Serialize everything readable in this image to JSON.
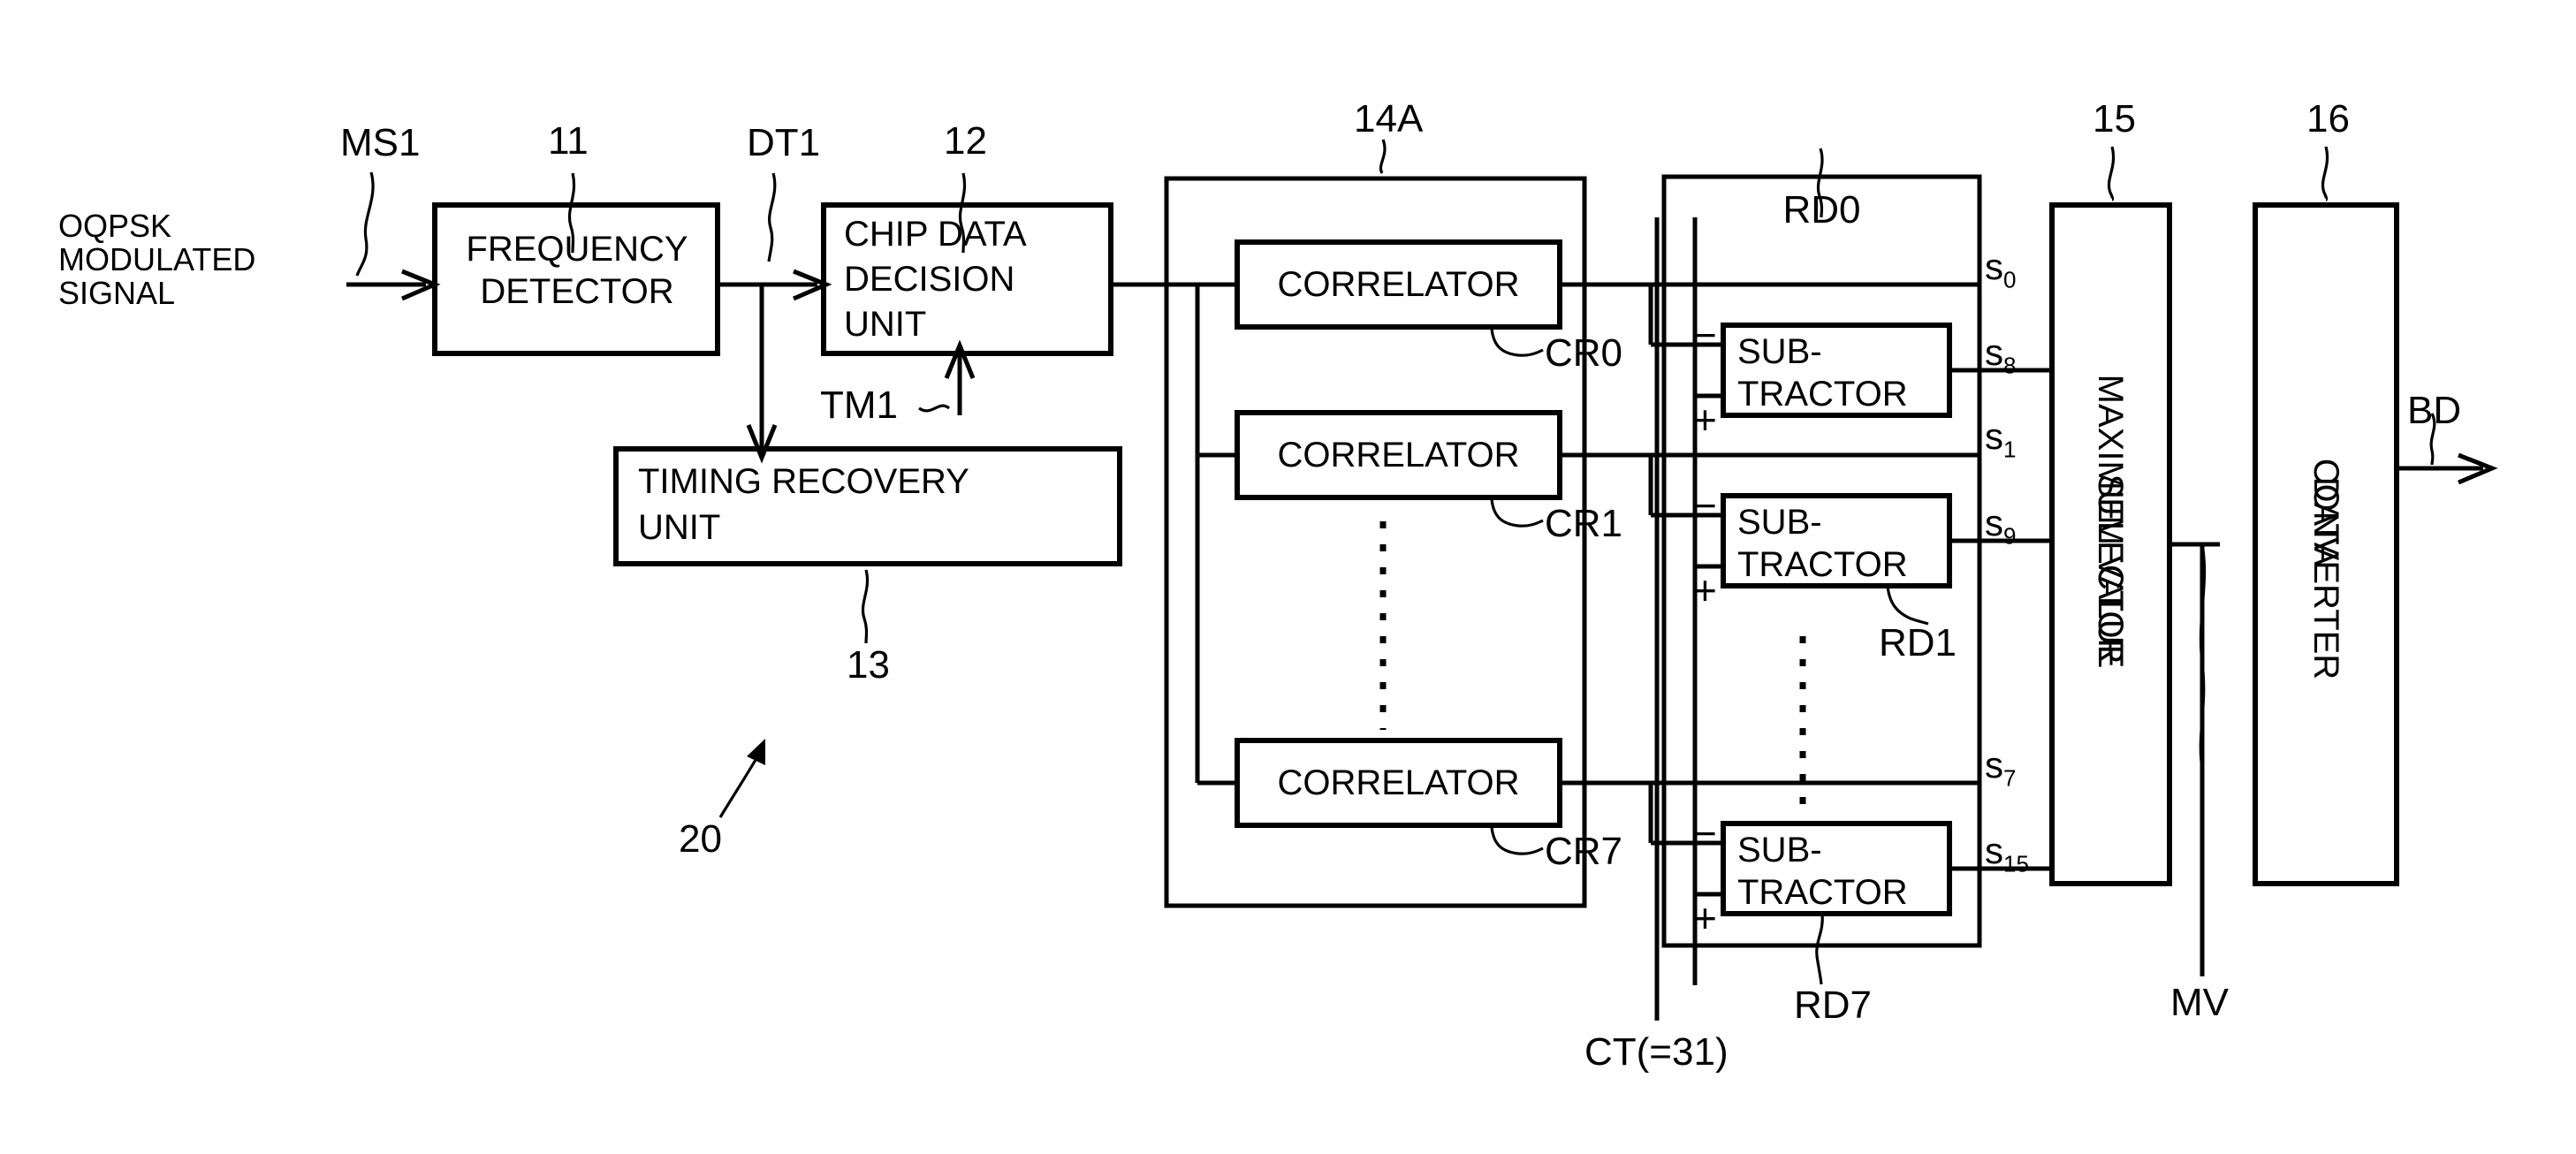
{
  "figure": {
    "type": "patent-block-diagram",
    "overall_ref": "20"
  },
  "input": {
    "label_line1": "OQPSK",
    "label_line2": "MODULATED",
    "label_line3": "SIGNAL",
    "signal_ref": "MS1"
  },
  "blocks": {
    "frequency_detector": {
      "line1": "FREQUENCY",
      "line2": "DETECTOR",
      "ref": "11"
    },
    "chip_data_decision_unit": {
      "line1": "CHIP DATA",
      "line2": "DECISION",
      "line3": "UNIT",
      "ref": "12"
    },
    "timing_recovery_unit": {
      "line1": "TIMING RECOVERY",
      "line2": "UNIT",
      "ref": "13"
    },
    "correlator_bank": {
      "ref": "14A",
      "items": [
        {
          "label": "CORRELATOR",
          "ref": "CR0"
        },
        {
          "label": "CORRELATOR",
          "ref": "CR1"
        },
        {
          "label": "CORRELATOR",
          "ref": "CR7"
        }
      ]
    },
    "subtractor_bank": {
      "top_ref": "RD0",
      "items": [
        {
          "line1": "SUB-",
          "line2": "TRACTOR",
          "ref": "RD0",
          "minus": "−",
          "plus": "+"
        },
        {
          "line1": "SUB-",
          "line2": "TRACTOR",
          "ref": "RD1",
          "minus": "−",
          "plus": "+"
        },
        {
          "line1": "SUB-",
          "line2": "TRACTOR",
          "ref": "RD7",
          "minus": "−",
          "plus": "+"
        }
      ]
    },
    "maximum_value_selector": {
      "line1": "MAXIMUM VALUE",
      "line2": "SELECTOR",
      "ref": "15"
    },
    "data_converter": {
      "line1": "DATA",
      "line2": "CONVERTER",
      "ref": "16"
    }
  },
  "signals": {
    "dt1": "DT1",
    "tm1": "TM1",
    "ct": "CT(=31)",
    "mv": "MV",
    "bd": "BD",
    "outputs": [
      {
        "base": "s",
        "sub": "0"
      },
      {
        "base": "s",
        "sub": "8"
      },
      {
        "base": "s",
        "sub": "1"
      },
      {
        "base": "s",
        "sub": "9"
      },
      {
        "base": "s",
        "sub": "7"
      },
      {
        "base": "s",
        "sub": "15"
      }
    ]
  },
  "colors": {
    "ink": "#000000",
    "paper": "#ffffff"
  }
}
